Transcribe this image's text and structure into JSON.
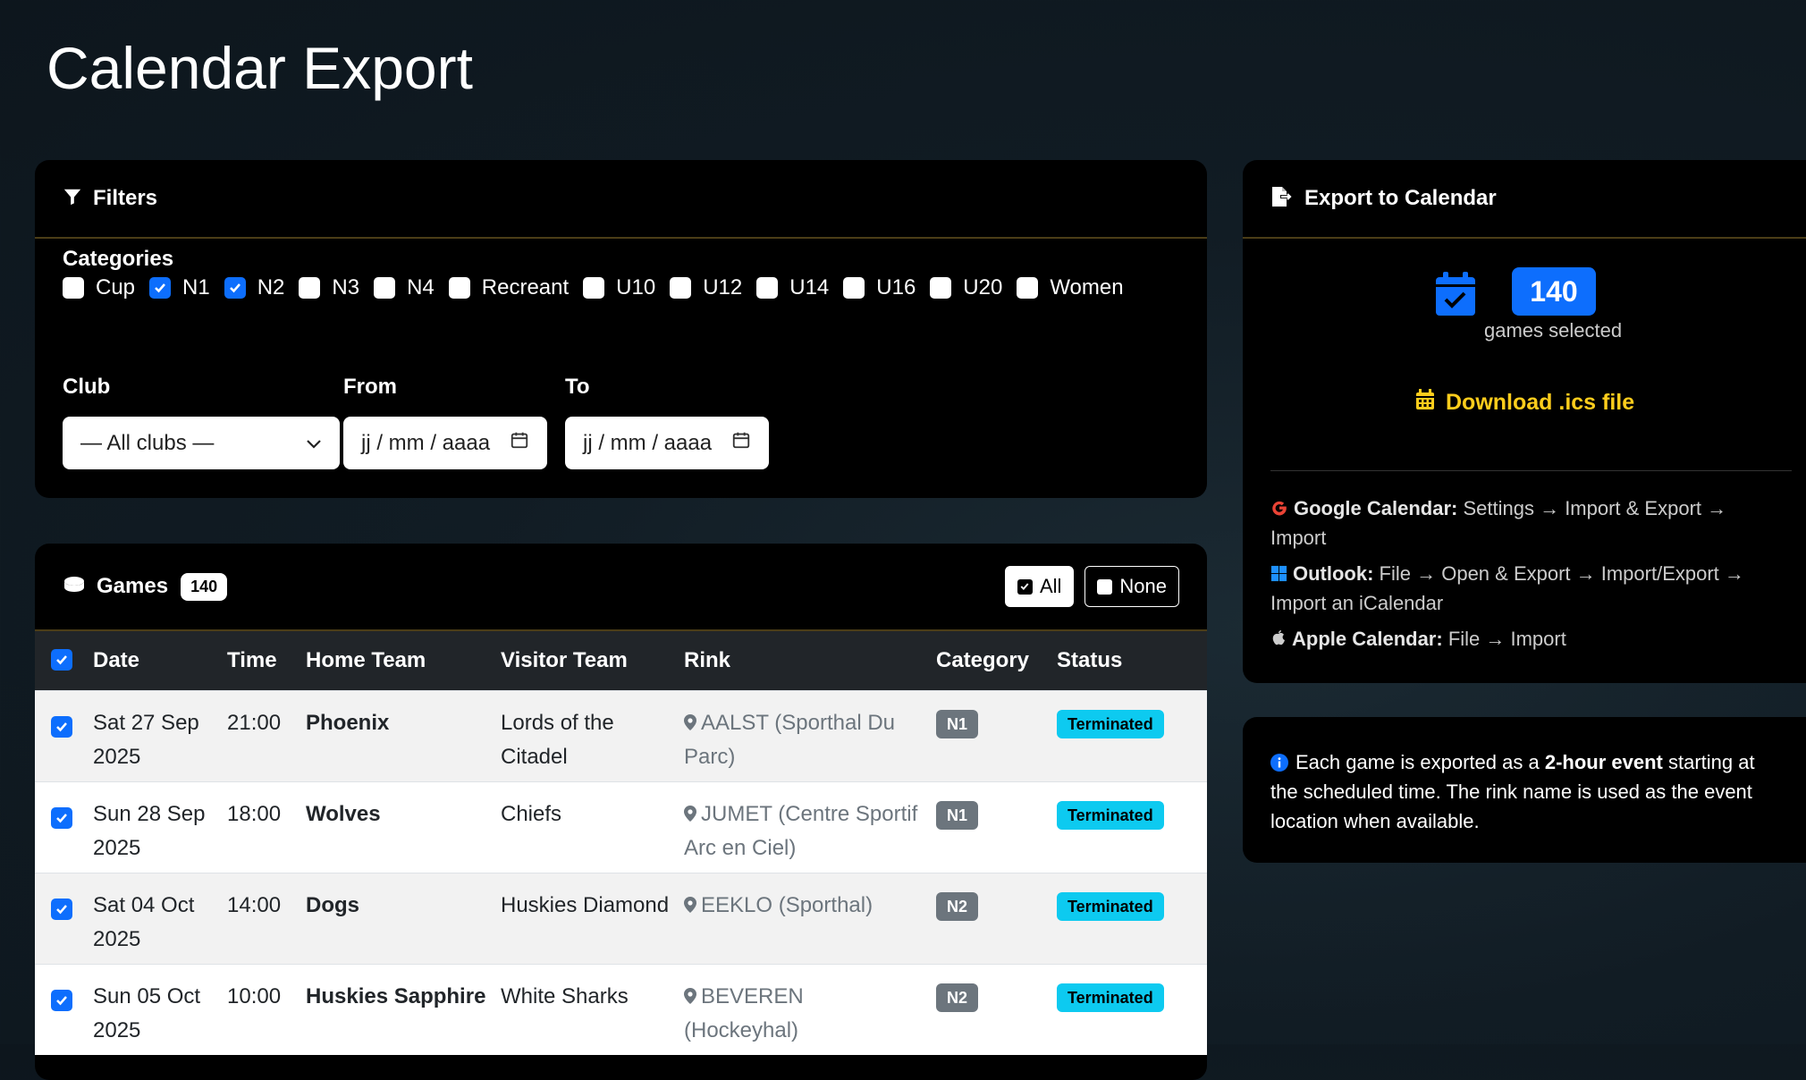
{
  "page": {
    "title": "Calendar Export"
  },
  "filters": {
    "heading": "Filters",
    "categories_label": "Categories",
    "categories": [
      {
        "label": "Cup",
        "checked": false
      },
      {
        "label": "N1",
        "checked": true
      },
      {
        "label": "N2",
        "checked": true
      },
      {
        "label": "N3",
        "checked": false
      },
      {
        "label": "N4",
        "checked": false
      },
      {
        "label": "Recreant",
        "checked": false
      },
      {
        "label": "U10",
        "checked": false
      },
      {
        "label": "U12",
        "checked": false
      },
      {
        "label": "U14",
        "checked": false
      },
      {
        "label": "U16",
        "checked": false
      },
      {
        "label": "U20",
        "checked": false
      },
      {
        "label": "Women",
        "checked": false
      }
    ],
    "club_label": "Club",
    "club_value": "— All clubs —",
    "from_label": "From",
    "from_placeholder": "jj / mm / aaaa",
    "to_label": "To",
    "to_placeholder": "jj / mm / aaaa"
  },
  "games": {
    "heading": "Games",
    "count": "140",
    "all_label": "All",
    "none_label": "None",
    "columns": [
      "Date",
      "Time",
      "Home Team",
      "Visitor Team",
      "Rink",
      "Category",
      "Status"
    ],
    "rows": [
      {
        "date": "Sat 27 Sep 2025",
        "time": "21:00",
        "home": "Phoenix",
        "visitor": "Lords of the Citadel",
        "rink": "AALST (Sporthal Du Parc)",
        "category": "N1",
        "status": "Terminated"
      },
      {
        "date": "Sun 28 Sep 2025",
        "time": "18:00",
        "home": "Wolves",
        "visitor": "Chiefs",
        "rink": "JUMET (Centre Sportif Arc en Ciel)",
        "category": "N1",
        "status": "Terminated"
      },
      {
        "date": "Sat 04 Oct 2025",
        "time": "14:00",
        "home": "Dogs",
        "visitor": "Huskies Diamond",
        "rink": "EEKLO (Sporthal)",
        "category": "N2",
        "status": "Terminated"
      },
      {
        "date": "Sun 05 Oct 2025",
        "time": "10:00",
        "home": "Huskies Sapphire",
        "visitor": "White Sharks",
        "rink": "BEVEREN (Hockeyhal)",
        "category": "N2",
        "status": "Terminated"
      }
    ]
  },
  "export": {
    "heading": "Export to Calendar",
    "selected_count": "140",
    "selected_text": "games selected",
    "download_label": "Download .ics file",
    "google_title": "Google Calendar:",
    "google_text": " Settings → Import & Export → Import",
    "outlook_title": "Outlook:",
    "outlook_text": " File → Open & Export → Import/Export → Import an iCalendar",
    "apple_title": "Apple Calendar:",
    "apple_text": " File → Import"
  },
  "info": {
    "text_before": "Each game is exported as a ",
    "text_bold": "2-hour event",
    "text_after": " starting at the scheduled time. The rink name is used as the event location when available."
  },
  "colors": {
    "accent": "#0d6efd",
    "download": "#ffcd1c",
    "status": "#0dcaf0",
    "category": "#6c757d"
  }
}
